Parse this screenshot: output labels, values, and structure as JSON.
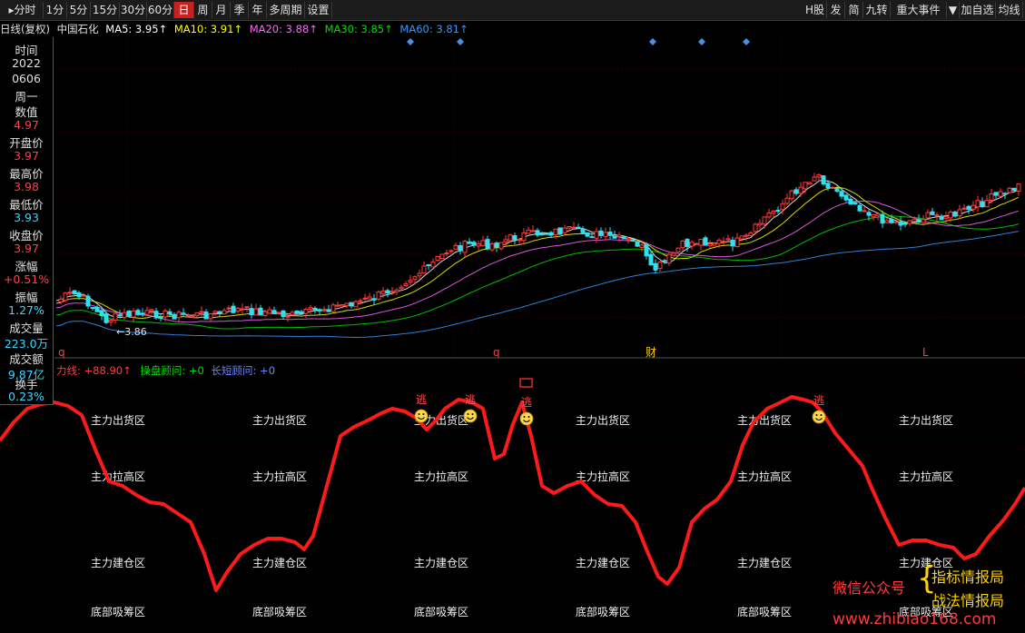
{
  "toolbar": {
    "left_items": [
      {
        "label": "▸分时",
        "active": false
      },
      {
        "label": "1分",
        "active": false
      },
      {
        "label": "5分",
        "active": false
      },
      {
        "label": "15分",
        "active": false
      },
      {
        "label": "30分",
        "active": false
      },
      {
        "label": "60分",
        "active": false
      },
      {
        "label": "日",
        "active": true
      },
      {
        "label": "周",
        "active": false
      },
      {
        "label": "月",
        "active": false
      },
      {
        "label": "季",
        "active": false
      },
      {
        "label": "年",
        "active": false
      },
      {
        "label": "多周期",
        "active": false
      },
      {
        "label": "设置",
        "active": false
      }
    ],
    "right_items": [
      "H股",
      "发",
      "简",
      "九转",
      "重大事件",
      "▼",
      "加自选",
      "均线"
    ]
  },
  "info_line": {
    "period": "日线(复权)",
    "stock": "中国石化",
    "ma5": "MA5: 3.95↑",
    "ma10": "MA10: 3.91↑",
    "ma20": "MA20: 3.88↑",
    "ma30": "MA30: 3.85↑",
    "ma60": "MA60: 3.81↑"
  },
  "sidebar": {
    "time_label": "时间",
    "year": "2022",
    "date": "0606",
    "weekday": "周一",
    "value_label": "数值",
    "value": "4.97",
    "open_label": "开盘价",
    "open": "3.97",
    "high_label": "最高价",
    "high": "3.98",
    "low_label": "最低价",
    "low": "3.93",
    "close_label": "收盘价",
    "close": "3.97",
    "change_label": "涨幅",
    "change": "+0.51%",
    "amplitude_label": "振幅",
    "amplitude": "1.27%",
    "volume_label": "成交量",
    "volume": "223.0万",
    "amount_label": "成交额",
    "amount": "9.87亿",
    "turnover_label": "换手",
    "turnover": "0.23%"
  },
  "main_chart": {
    "min_price_label": "←3.86",
    "markers": [
      "q",
      "q",
      "财",
      "L"
    ]
  },
  "indicator": {
    "legend_main": "力线: +88.90↑",
    "legend_op": "操盘顾问: +0",
    "legend_long": "长短顾问: +0",
    "zone_labels": {
      "sell": "主力出货区",
      "pull": "主力拉高区",
      "build": "主力建仓区",
      "bottom": "底部吸筹区"
    },
    "escape_label": "逃"
  },
  "watermark": {
    "wechat": "微信公众号",
    "name1": "指标情报局",
    "name2": "战法情报局",
    "site": "www.zhibiao168.com"
  },
  "colors": {
    "up": "#ff3c3c",
    "down": "#30e0f0",
    "ma5": "#ffffff",
    "ma10": "#ffff00",
    "ma20": "#ff66ff",
    "ma30": "#00dd00",
    "ma60": "#3399ff",
    "power_line": "#ff1a1a",
    "active_tab": "#c91f1f"
  }
}
